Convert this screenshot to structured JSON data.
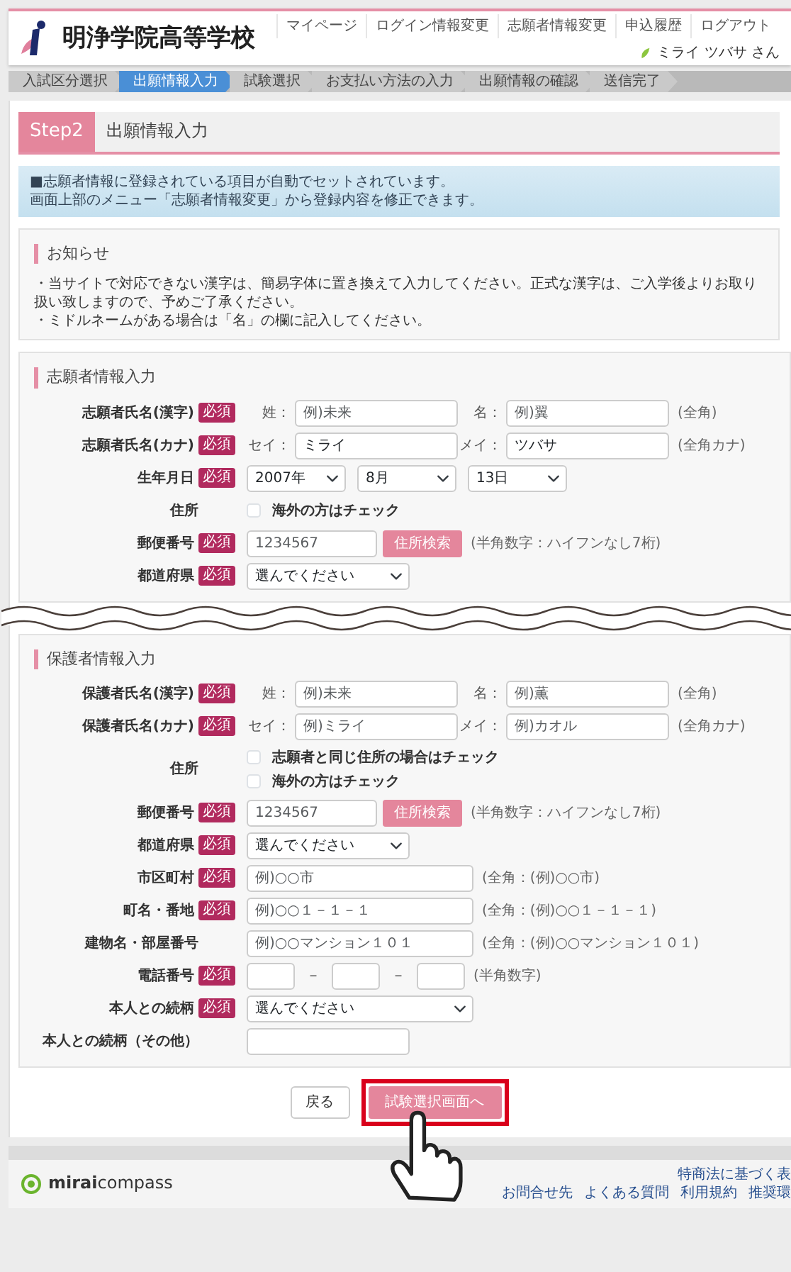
{
  "header": {
    "school_name": "明浄学院高等学校",
    "nav": [
      "マイページ",
      "ログイン情報変更",
      "志願者情報変更",
      "申込履歴",
      "ログアウト"
    ],
    "user": "ミライ ツバサ さん"
  },
  "steps": [
    {
      "label": "入試区分選択",
      "selected": false
    },
    {
      "label": "出願情報入力",
      "selected": true
    },
    {
      "label": "試験選択",
      "selected": false
    },
    {
      "label": "お支払い方法の入力",
      "selected": false
    },
    {
      "label": "出願情報の確認",
      "selected": false
    },
    {
      "label": "送信完了",
      "selected": false
    }
  ],
  "page_title": {
    "step": "Step2",
    "title": "出願情報入力"
  },
  "info": [
    "■志願者情報に登録されている項目が自動でセットされています。",
    "画面上部のメニュー「志願者情報変更」から登録内容を修正できます。"
  ],
  "notice": {
    "title": "お知らせ",
    "lines": [
      "・当サイトで対応できない漢字は、簡易字体に置き換えて入力してください。正式な漢字は、ご入学後よりお取り扱い致しますので、予めご了承ください。",
      "・ミドルネームがある場合は「名」の欄に記入してください。"
    ]
  },
  "sections": [
    {
      "title": "志願者情報入力",
      "rows": [
        {
          "kind": "name",
          "label": "志願者氏名(漢字)",
          "badge": "必須",
          "fields": [
            {
              "prefix": "姓：",
              "placeholder": "例)未来"
            },
            {
              "prefix": "名：",
              "placeholder": "例)翼"
            }
          ],
          "note": "(全角)"
        },
        {
          "kind": "name",
          "label": "志願者氏名(カナ)",
          "badge": "必須",
          "fields": [
            {
              "prefix": "セイ：",
              "value": "ミライ"
            },
            {
              "prefix": "メイ：",
              "value": "ツバサ"
            }
          ],
          "note": "(全角カナ)"
        },
        {
          "kind": "date",
          "label": "生年月日",
          "badge": "必須",
          "selects": [
            "2007年",
            "8月",
            "13日"
          ]
        },
        {
          "kind": "checks",
          "label": "住所",
          "items": [
            {
              "label": "海外の方はチェック",
              "checked": false
            }
          ]
        },
        {
          "kind": "postal",
          "label": "郵便番号",
          "badge": "必須",
          "placeholder": "1234567",
          "button": "住所検索",
          "note": "(半角数字：ハイフンなし7桁)"
        },
        {
          "kind": "select",
          "label": "都道府県",
          "badge": "必須",
          "value": "選んでください"
        }
      ]
    },
    {
      "title": "保護者情報入力",
      "rows": [
        {
          "kind": "name",
          "label": "保護者氏名(漢字)",
          "badge": "必須",
          "fields": [
            {
              "prefix": "姓：",
              "placeholder": "例)未来"
            },
            {
              "prefix": "名：",
              "placeholder": "例)薫"
            }
          ],
          "note": "(全角)"
        },
        {
          "kind": "name",
          "label": "保護者氏名(カナ)",
          "badge": "必須",
          "fields": [
            {
              "prefix": "セイ：",
              "placeholder": "例)ミライ"
            },
            {
              "prefix": "メイ：",
              "placeholder": "例)カオル"
            }
          ],
          "note": "(全角カナ)"
        },
        {
          "kind": "checks",
          "label": "住所",
          "items": [
            {
              "label": "志願者と同じ住所の場合はチェック",
              "checked": false
            },
            {
              "label": "海外の方はチェック",
              "checked": false
            }
          ]
        },
        {
          "kind": "postal",
          "label": "郵便番号",
          "badge": "必須",
          "placeholder": "1234567",
          "button": "住所検索",
          "note": "(半角数字：ハイフンなし7桁)"
        },
        {
          "kind": "select",
          "label": "都道府県",
          "badge": "必須",
          "value": "選んでください"
        },
        {
          "kind": "text",
          "label": "市区町村",
          "badge": "必須",
          "placeholder": "例)○○市",
          "note": "(全角：(例)○○市)"
        },
        {
          "kind": "text",
          "label": "町名・番地",
          "badge": "必須",
          "placeholder": "例)○○１－１－１",
          "note": "(全角：(例)○○１－１－１)"
        },
        {
          "kind": "text",
          "label": "建物名・部屋番号",
          "placeholder": "例)○○マンション１０１",
          "note": "(全角：(例)○○マンション１０１)"
        },
        {
          "kind": "phone",
          "label": "電話番号",
          "badge": "必須",
          "separators": [
            "－",
            "－"
          ],
          "note": "(半角数字)"
        },
        {
          "kind": "wideselect",
          "label": "本人との続柄",
          "badge": "必須",
          "value": "選んでください"
        },
        {
          "kind": "shorttext",
          "label": "本人との続柄（その他）"
        }
      ]
    }
  ],
  "buttons": {
    "back": "戻る",
    "next": "試験選択画面へ"
  },
  "footer": {
    "logo": "**mirai**compass",
    "top_link": "特商法に基づく表",
    "links": [
      "お問合せ先",
      "よくある質問",
      "利用規約",
      "推奨環"
    ]
  }
}
